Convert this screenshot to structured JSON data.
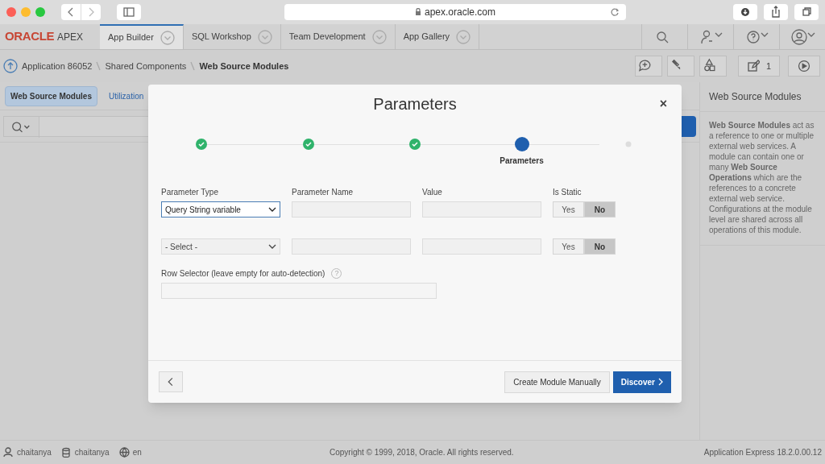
{
  "browser": {
    "url": "apex.oracle.com"
  },
  "nav": {
    "logo": "ORACLE",
    "logo_suffix": "APEX",
    "tabs": [
      {
        "label": "App Builder",
        "selected": true
      },
      {
        "label": "SQL Workshop",
        "selected": false
      },
      {
        "label": "Team Development",
        "selected": false
      },
      {
        "label": "App Gallery",
        "selected": false
      }
    ]
  },
  "breadcrumb": [
    {
      "label": "Application 86052",
      "current": false
    },
    {
      "label": "Shared Components",
      "current": false
    },
    {
      "label": "Web Source Modules",
      "current": true
    }
  ],
  "toolbar": {
    "edit_count": "1"
  },
  "page_tabs": [
    {
      "label": "Web Source Modules",
      "selected": true
    },
    {
      "label": "Utilization",
      "selected": false
    }
  ],
  "side_panel": {
    "title": "Web Source Modules",
    "text": "**Web Source Modules** act as a reference to one or multiple external web services. A module can contain one or many **Web Source Operations** which are the references to a concrete external web service. Configurations at the module level are shared across all operations of this module."
  },
  "dialog": {
    "title": "Parameters",
    "close": "×",
    "steps": [
      {
        "done": true,
        "current": false
      },
      {
        "done": true,
        "current": false
      },
      {
        "done": true,
        "current": false
      },
      {
        "done": false,
        "current": true,
        "label": "Parameters"
      },
      {
        "done": false,
        "current": false
      }
    ],
    "columns": [
      "Parameter Type",
      "Parameter Name",
      "Value",
      "Is Static"
    ],
    "rows": [
      {
        "type": "Query String variable",
        "focused": true,
        "static": [
          {
            "label": "Yes",
            "selected": false
          },
          {
            "label": "No",
            "selected": true
          }
        ]
      },
      {
        "type": "- Select -",
        "focused": false,
        "static": [
          {
            "label": "Yes",
            "selected": false
          },
          {
            "label": "No",
            "selected": true
          }
        ]
      }
    ],
    "row_selector_label": "Row Selector (leave empty for auto-detection)",
    "help": "?",
    "buttons": [
      {
        "label": "Create Module Manually",
        "kind": "secondary"
      },
      {
        "label": "Discover",
        "kind": "primary"
      }
    ]
  },
  "footer": {
    "user": "chaitanya",
    "schema": "chaitanya",
    "language": "en",
    "copyright": "Copyright © 1999, 2018, Oracle. All rights reserved.",
    "version": "Application Express 18.2.0.00.12"
  }
}
